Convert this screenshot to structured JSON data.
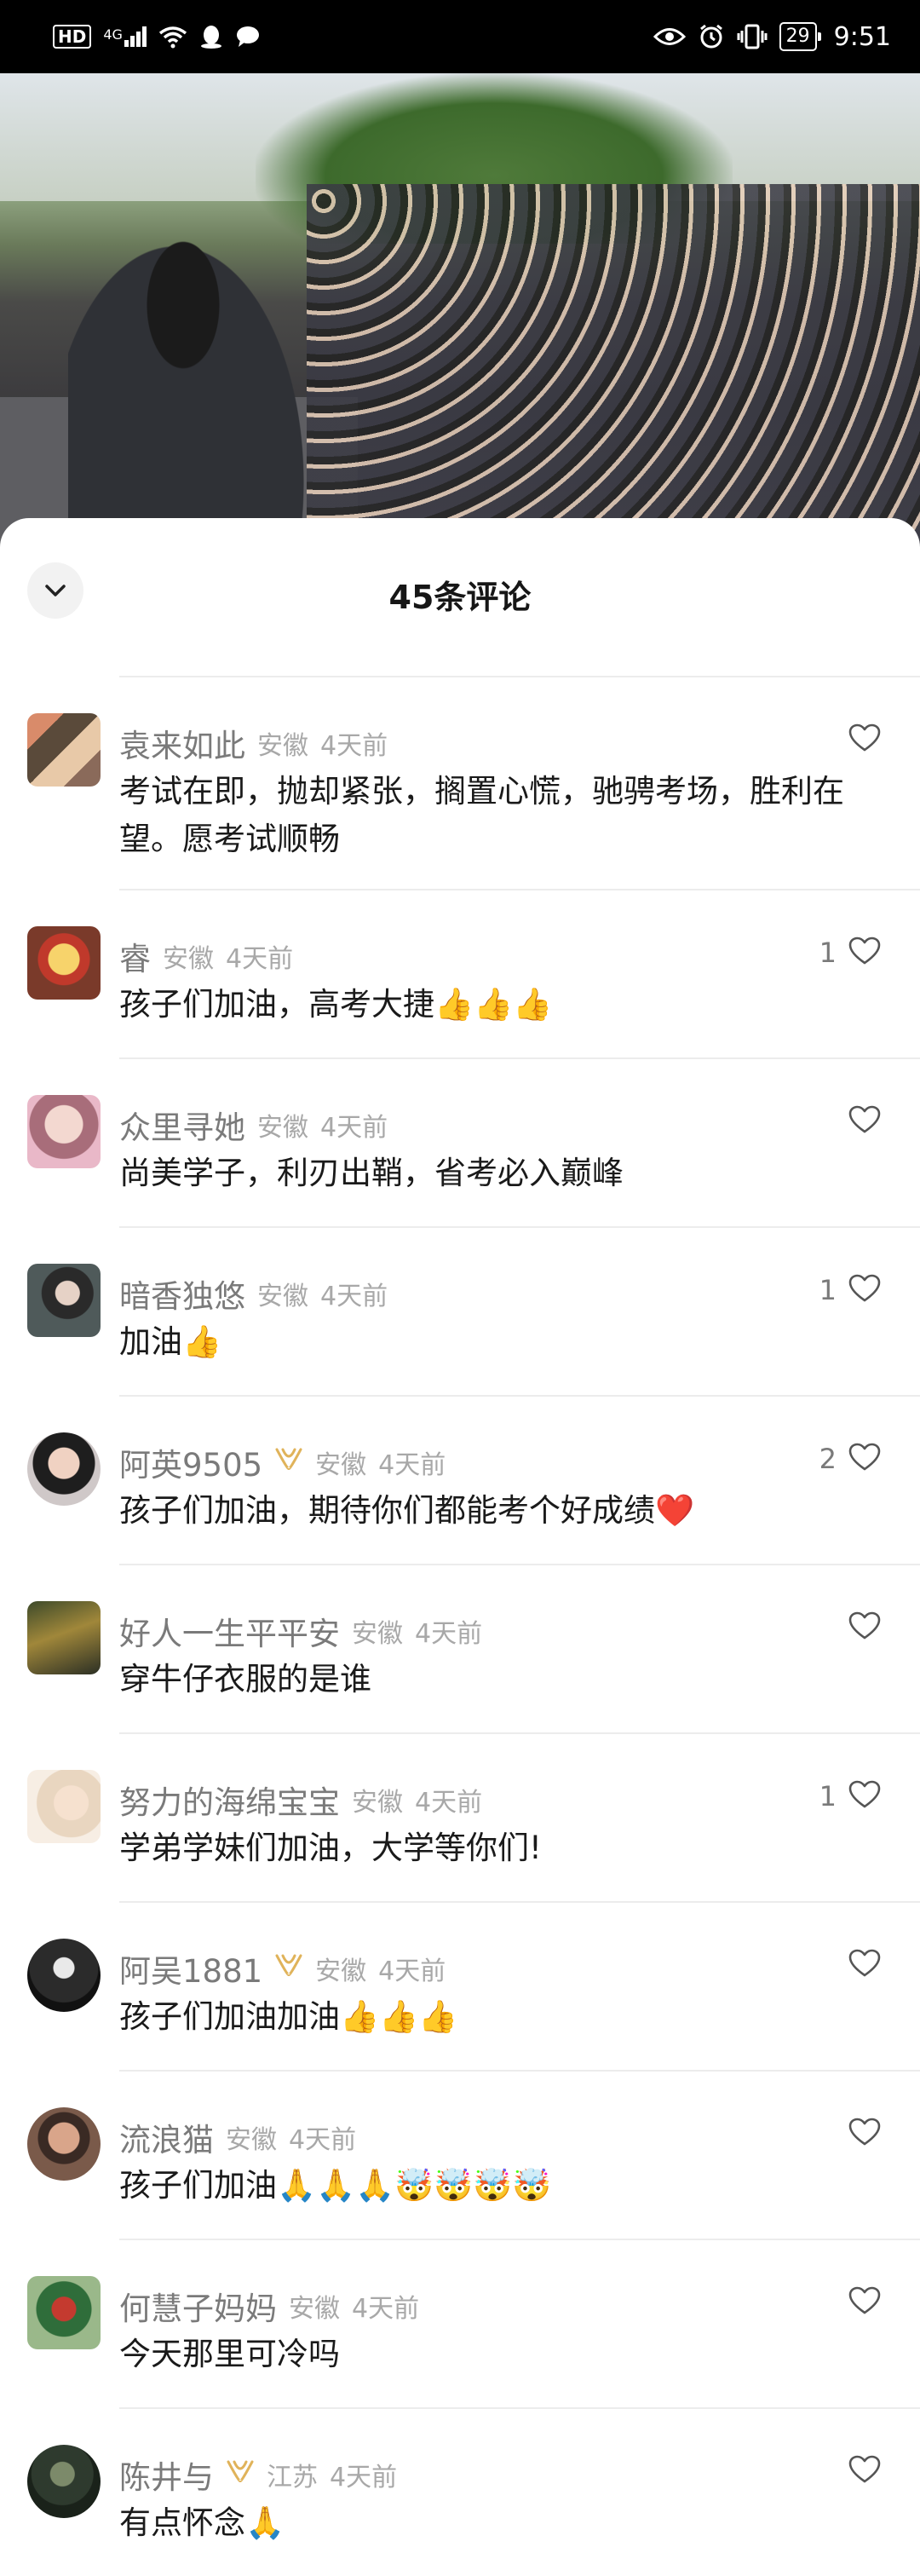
{
  "status_bar": {
    "hd": "HD",
    "network": "4G",
    "battery": "29",
    "time": "9:51"
  },
  "sheet": {
    "title": "45条评论"
  },
  "comments": [
    {
      "name": "袁来如此",
      "vip": false,
      "region": "安徽",
      "time": "4天前",
      "text": "考试在即，抛却紧张，搁置心慌，驰骋考场，胜利在望。愿考试顺畅",
      "likes": ""
    },
    {
      "name": "睿",
      "vip": false,
      "region": "安徽",
      "time": "4天前",
      "text": "孩子们加油，高考大捷👍👍👍",
      "likes": "1"
    },
    {
      "name": "众里寻她",
      "vip": false,
      "region": "安徽",
      "time": "4天前",
      "text": "尚美学子，利刃出鞘，省考必入巅峰",
      "likes": ""
    },
    {
      "name": "暗香独悠",
      "vip": false,
      "region": "安徽",
      "time": "4天前",
      "text": "加油👍",
      "likes": "1"
    },
    {
      "name": "阿英9505",
      "vip": true,
      "region": "安徽",
      "time": "4天前",
      "text": "孩子们加油，期待你们都能考个好成绩❤️",
      "likes": "2"
    },
    {
      "name": "好人一生平平安",
      "vip": false,
      "region": "安徽",
      "time": "4天前",
      "text": "穿牛仔衣服的是谁",
      "likes": ""
    },
    {
      "name": "努力的海绵宝宝",
      "vip": false,
      "region": "安徽",
      "time": "4天前",
      "text": "学弟学妹们加油，大学等你们!",
      "likes": "1"
    },
    {
      "name": "阿吴1881",
      "vip": true,
      "region": "安徽",
      "time": "4天前",
      "text": "孩子们加油加油👍👍👍",
      "likes": ""
    },
    {
      "name": "流浪猫",
      "vip": false,
      "region": "安徽",
      "time": "4天前",
      "text": "孩子们加油🙏🙏🙏🤯🤯🤯🤯",
      "likes": ""
    },
    {
      "name": "何慧子妈妈",
      "vip": false,
      "region": "安徽",
      "time": "4天前",
      "text": "今天那里可冷吗",
      "likes": ""
    },
    {
      "name": "陈井与",
      "vip": true,
      "region": "江苏",
      "time": "4天前",
      "text": "有点怀念🙏",
      "likes": ""
    }
  ],
  "icons": {
    "collapse": "chevron-down-icon",
    "like": "heart-outline-icon",
    "vip": "vip-badge-icon"
  },
  "colors": {
    "text_primary": "#1a1a1a",
    "text_secondary": "#7a7a7a",
    "text_meta": "#a8a8a8",
    "vip": "#e0b35a"
  }
}
